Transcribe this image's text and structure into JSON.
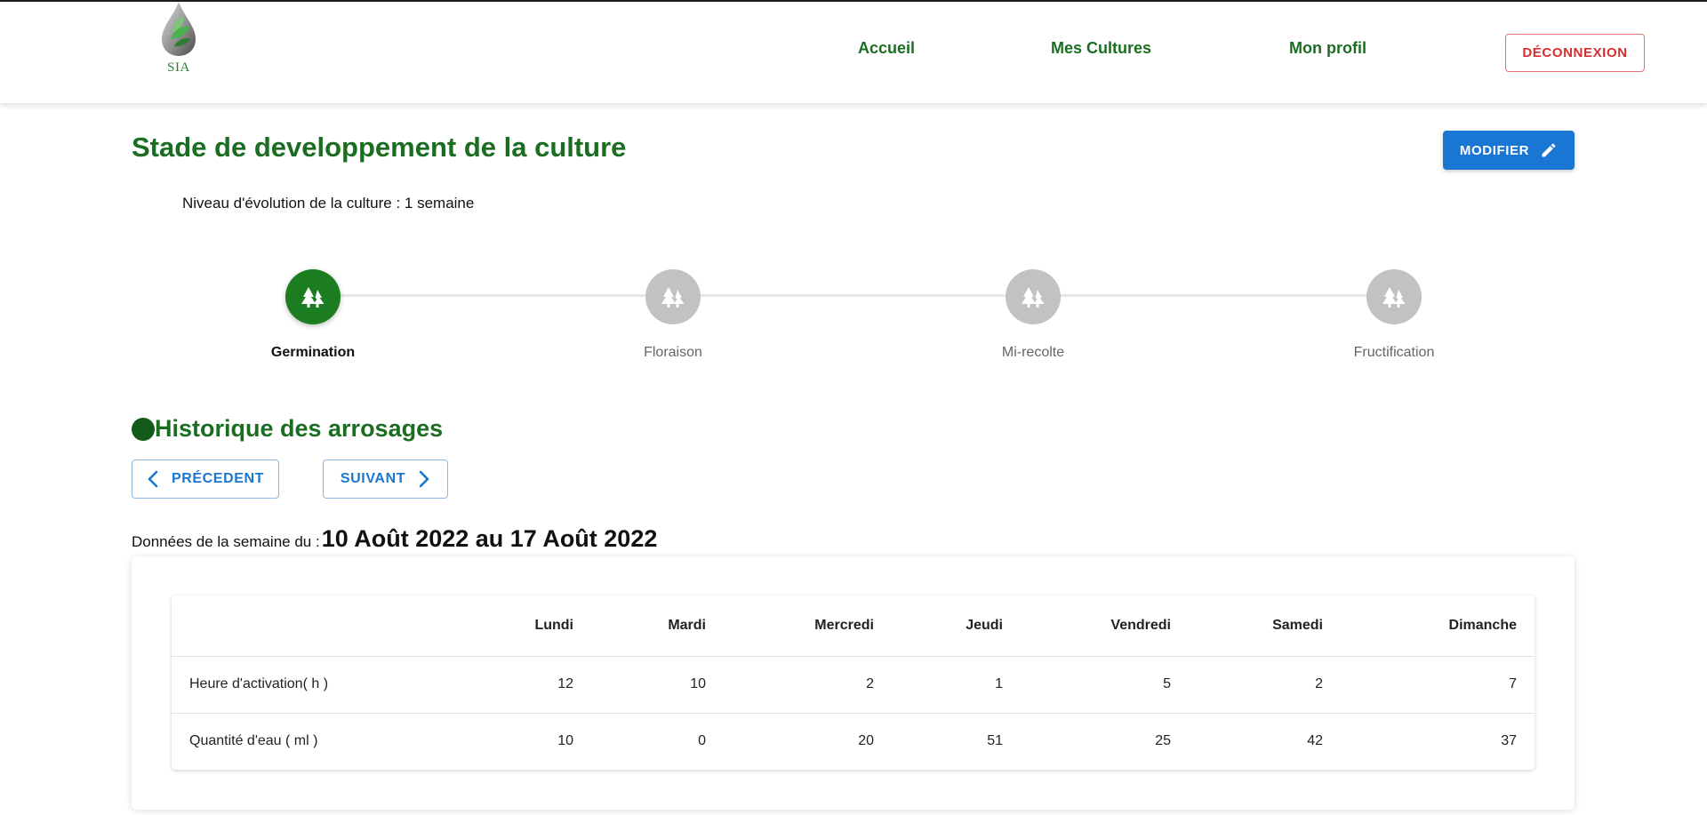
{
  "brand": {
    "logo_text": "SIA"
  },
  "nav": {
    "links": [
      "Accueil",
      "Mes Cultures",
      "Mon profil"
    ],
    "logout_label": "DÉCONNEXION"
  },
  "header": {
    "title": "Stade de developpement de la culture",
    "edit_label": "MODIFIER",
    "level_text": "Niveau d'évolution de la culture : 1 semaine"
  },
  "stepper": {
    "steps": [
      "Germination",
      "Floraison",
      "Mi-recolte",
      "Fructification"
    ],
    "active_index": 0
  },
  "history": {
    "title": "Historique des arrosages",
    "prev_label": "PRÉCEDENT",
    "next_label": "SUIVANT",
    "week_prefix": "Données de la semaine du :",
    "week_range": "10 Août 2022 au 17 Août 2022"
  },
  "table": {
    "columns": [
      "",
      "Lundi",
      "Mardi",
      "Mercredi",
      "Jeudi",
      "Vendredi",
      "Samedi",
      "Dimanche"
    ],
    "rows": [
      [
        "Heure d'activation( h )",
        "12",
        "10",
        "2",
        "1",
        "5",
        "2",
        "7"
      ],
      [
        "Quantité d'eau ( ml )",
        "10",
        "0",
        "20",
        "51",
        "25",
        "42",
        "37"
      ]
    ]
  },
  "colors": {
    "primary_green": "#1b6e21",
    "active_step": "#1b7d1f",
    "inactive_step": "#c2c2c2",
    "primary_blue": "#1976d2",
    "logout_red": "#d32f2f"
  },
  "icons": {
    "step_icon": "forest-icon",
    "edit_icon": "pencil-icon",
    "prev_icon": "chevron-left-icon",
    "next_icon": "chevron-right-icon"
  }
}
